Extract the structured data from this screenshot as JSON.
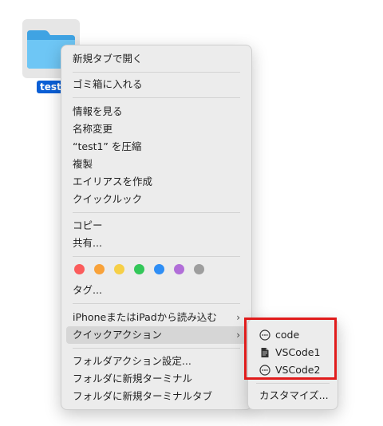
{
  "desktop": {
    "folder_label": "test1"
  },
  "context_menu": {
    "open_new_tab": "新規タブで開く",
    "move_to_trash": "ゴミ箱に入れる",
    "get_info": "情報を見る",
    "rename": "名称変更",
    "compress": "“test1” を圧縮",
    "duplicate": "複製",
    "make_alias": "エイリアスを作成",
    "quick_look": "クイックルック",
    "copy": "コピー",
    "share": "共有...",
    "tags_label": "タグ...",
    "import_from_iphone": "iPhoneまたはiPadから読み込む",
    "quick_actions": "クイックアクション",
    "folder_actions_setup": "フォルダアクション設定...",
    "new_terminal_at_folder": "フォルダに新規ターミナル",
    "new_terminal_tab_at_folder": "フォルダに新規ターミナルタブ",
    "submenu_chevron": "›"
  },
  "tag_colors": [
    "#fb5c5c",
    "#f8a23a",
    "#f6cf47",
    "#33c759",
    "#2f8ef5",
    "#b16ed8",
    "#9e9e9e"
  ],
  "quick_actions_submenu": {
    "items": [
      {
        "label": "code",
        "icon": "ellipsis-circle-icon"
      },
      {
        "label": "VSCode1",
        "icon": "document-icon"
      },
      {
        "label": "VSCode2",
        "icon": "ellipsis-circle-icon"
      }
    ],
    "customize": "カスタマイズ..."
  },
  "annotation_color": "#e01b1b"
}
